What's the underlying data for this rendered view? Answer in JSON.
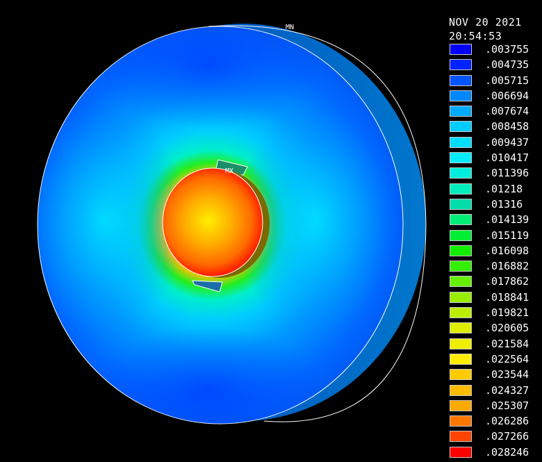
{
  "header": {
    "date": "NOV 20 2021",
    "time": "20:54:53"
  },
  "markers": {
    "min_label": "MN",
    "max_label": "MX"
  },
  "legend": [
    {
      "value": ".003755",
      "color": "#0000ff"
    },
    {
      "value": ".004735",
      "color": "#0022ff"
    },
    {
      "value": ".005715",
      "color": "#0055ff"
    },
    {
      "value": ".006694",
      "color": "#0088ff"
    },
    {
      "value": ".007674",
      "color": "#00aaff"
    },
    {
      "value": ".008458",
      "color": "#00ccff"
    },
    {
      "value": ".009437",
      "color": "#00ddff"
    },
    {
      "value": ".010417",
      "color": "#00eeff"
    },
    {
      "value": ".011396",
      "color": "#00eedd"
    },
    {
      "value": ".01218",
      "color": "#00eebb"
    },
    {
      "value": ".01316",
      "color": "#00ddaa"
    },
    {
      "value": ".014139",
      "color": "#00ee77"
    },
    {
      "value": ".015119",
      "color": "#00ee33"
    },
    {
      "value": ".016098",
      "color": "#11ee00"
    },
    {
      "value": ".016882",
      "color": "#33ee00"
    },
    {
      "value": ".017862",
      "color": "#66ee00"
    },
    {
      "value": ".018841",
      "color": "#99ee00"
    },
    {
      "value": ".019821",
      "color": "#bbee00"
    },
    {
      "value": ".020605",
      "color": "#ddee00"
    },
    {
      "value": ".021584",
      "color": "#eeee00"
    },
    {
      "value": ".022564",
      "color": "#ffee00"
    },
    {
      "value": ".023544",
      "color": "#ffcc00"
    },
    {
      "value": ".024327",
      "color": "#ffbb00"
    },
    {
      "value": ".025307",
      "color": "#ffaa00"
    },
    {
      "value": ".026286",
      "color": "#ff7700"
    },
    {
      "value": ".027266",
      "color": "#ff4400"
    },
    {
      "value": ".028246",
      "color": "#ff0000"
    }
  ]
}
